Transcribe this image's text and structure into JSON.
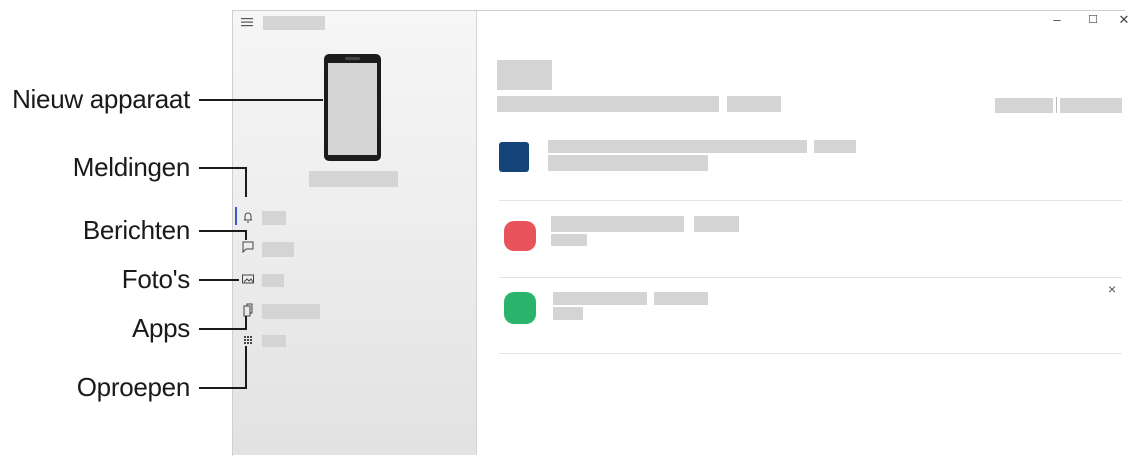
{
  "callouts": {
    "new_device": "Nieuw apparaat",
    "notifications": "Meldingen",
    "messages": "Berichten",
    "photos": "Foto's",
    "apps": "Apps",
    "calls": "Oproepen"
  },
  "window_controls": {
    "minimize": "–",
    "maximize": "☐",
    "close": "✕"
  },
  "notification_close": "×",
  "icons": {
    "menu": "hamburger-menu-icon",
    "notifications": "bell-icon",
    "messages": "chat-bubble-icon",
    "photos": "image-icon",
    "apps": "apps-icon",
    "calls": "dialpad-icon"
  },
  "colors": {
    "notif_1": "#14447a",
    "notif_2": "#e8525a",
    "notif_3": "#2ab36a",
    "active_indicator": "#3b5cc4"
  }
}
